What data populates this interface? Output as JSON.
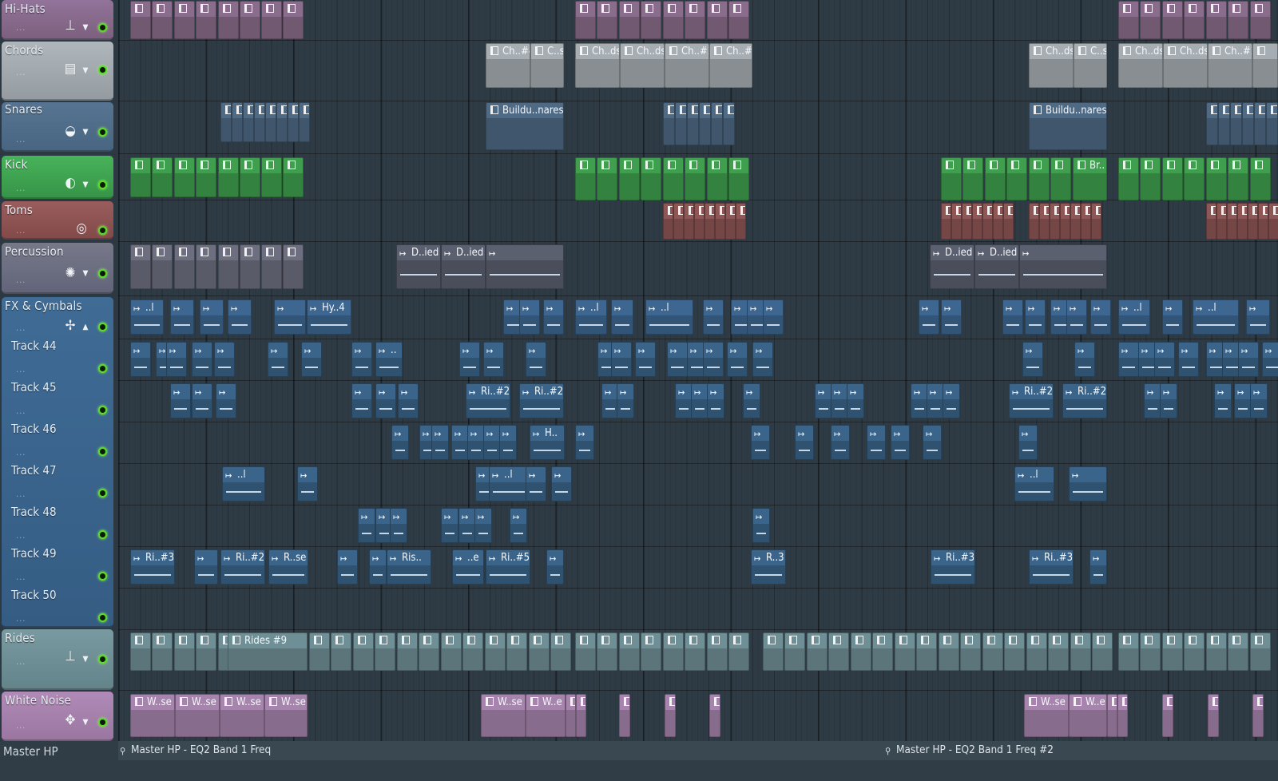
{
  "tracks": [
    {
      "id": "hihats",
      "name": "Hi-Hats",
      "dots": "...",
      "icon": "⊥",
      "arrow": "▼"
    },
    {
      "id": "chords",
      "name": "Chords",
      "dots": "...",
      "icon": "▤",
      "arrow": "▼"
    },
    {
      "id": "snares",
      "name": "Snares",
      "dots": "...",
      "icon": "◒",
      "arrow": "▼"
    },
    {
      "id": "kick",
      "name": "Kick",
      "dots": "...",
      "icon": "◐",
      "arrow": "▼"
    },
    {
      "id": "toms",
      "name": "Toms",
      "dots": "...",
      "icon": "◎",
      "arrow": ""
    },
    {
      "id": "percussion",
      "name": "Percussion",
      "dots": "...",
      "icon": "✺",
      "arrow": "▼"
    },
    {
      "id": "fx",
      "name": "FX & Cymbals",
      "dots": "...",
      "icon": "✢",
      "arrow": "▲"
    },
    {
      "id": "rides",
      "name": "Rides",
      "dots": "...",
      "icon": "⊥",
      "arrow": "▼"
    },
    {
      "id": "whitenoise",
      "name": "White Noise",
      "dots": "...",
      "icon": "✥",
      "arrow": "▼"
    }
  ],
  "sub_tracks": [
    "Track 44",
    "Track 45",
    "Track 46",
    "Track 47",
    "Track 48",
    "Track 49",
    "Track 50"
  ],
  "clip_labels": {
    "chords_1": "Ch..#4",
    "chords_2": "C..s",
    "chords_3": "Ch..ds",
    "chords_4": "Ch..ds",
    "chords_5": "Ch..#3",
    "chords_6": "Ch..#3",
    "chords_7": "Ch..ds",
    "chords_8": "C..s",
    "chords_9": "Ch..ds",
    "chords_10": "Ch..ds",
    "chords_11": "Ch..#3",
    "snares_build_1": "Buildu..nares",
    "snares_build_2": "Buildu..nares",
    "kick_br": "Br..",
    "perc_d1": "D..ied",
    "perc_d2": "D..ied",
    "perc_d3": "D..ied",
    "perc_d4": "D..ied",
    "fx_l1": "..l",
    "fx_hy": "Hy..4",
    "fx_l2": "..l",
    "fx_l3": "..l",
    "fx_l4": "..l",
    "fx_l5": "..l",
    "t44_a": "..",
    "t45_ri1": "Ri..#2",
    "t45_ri2": "Ri..#2",
    "t45_ri3": "Ri..#2",
    "t45_ri4": "Ri..#2",
    "t46_h": "H..",
    "t47_l1": "..l",
    "t47_l2": "..l",
    "t47_l3": "..l",
    "t49_ri3": "Ri..#3",
    "t49_ri2": "Ri..#2",
    "t49_rse": "R..se",
    "t49_ris": "Ris..",
    "t49_e": "..e",
    "t49_ri5": "Ri..#5",
    "t49_r3": "R..3",
    "t49_ri3b": "Ri..#3",
    "t49_ri3c": "Ri..#3",
    "rides_9": "Rides #9",
    "wn_1": "W..se",
    "wn_2": "W..se",
    "wn_3": "W..se",
    "wn_4": "W..se",
    "wn_5": "W..se",
    "wn_6": "W..e",
    "wn_7": "W..se",
    "wn_8": "W..e"
  },
  "bottom": {
    "track_name": "Master HP",
    "automation_1": "Master HP - EQ2 Band 1 Freq",
    "automation_2": "Master HP - EQ2 Band 1 Freq #2"
  },
  "colors": {
    "hihats": "#8a6d8c",
    "chords": "#a7aeb3",
    "snares": "#4e6a85",
    "kick": "#3f9f4f",
    "toms": "#8f5656",
    "percussion": "#6d6f80",
    "fx": "#3d6790",
    "rides": "#6f8f96",
    "whitenoise": "#a684ad",
    "sub": "#3a6489"
  }
}
